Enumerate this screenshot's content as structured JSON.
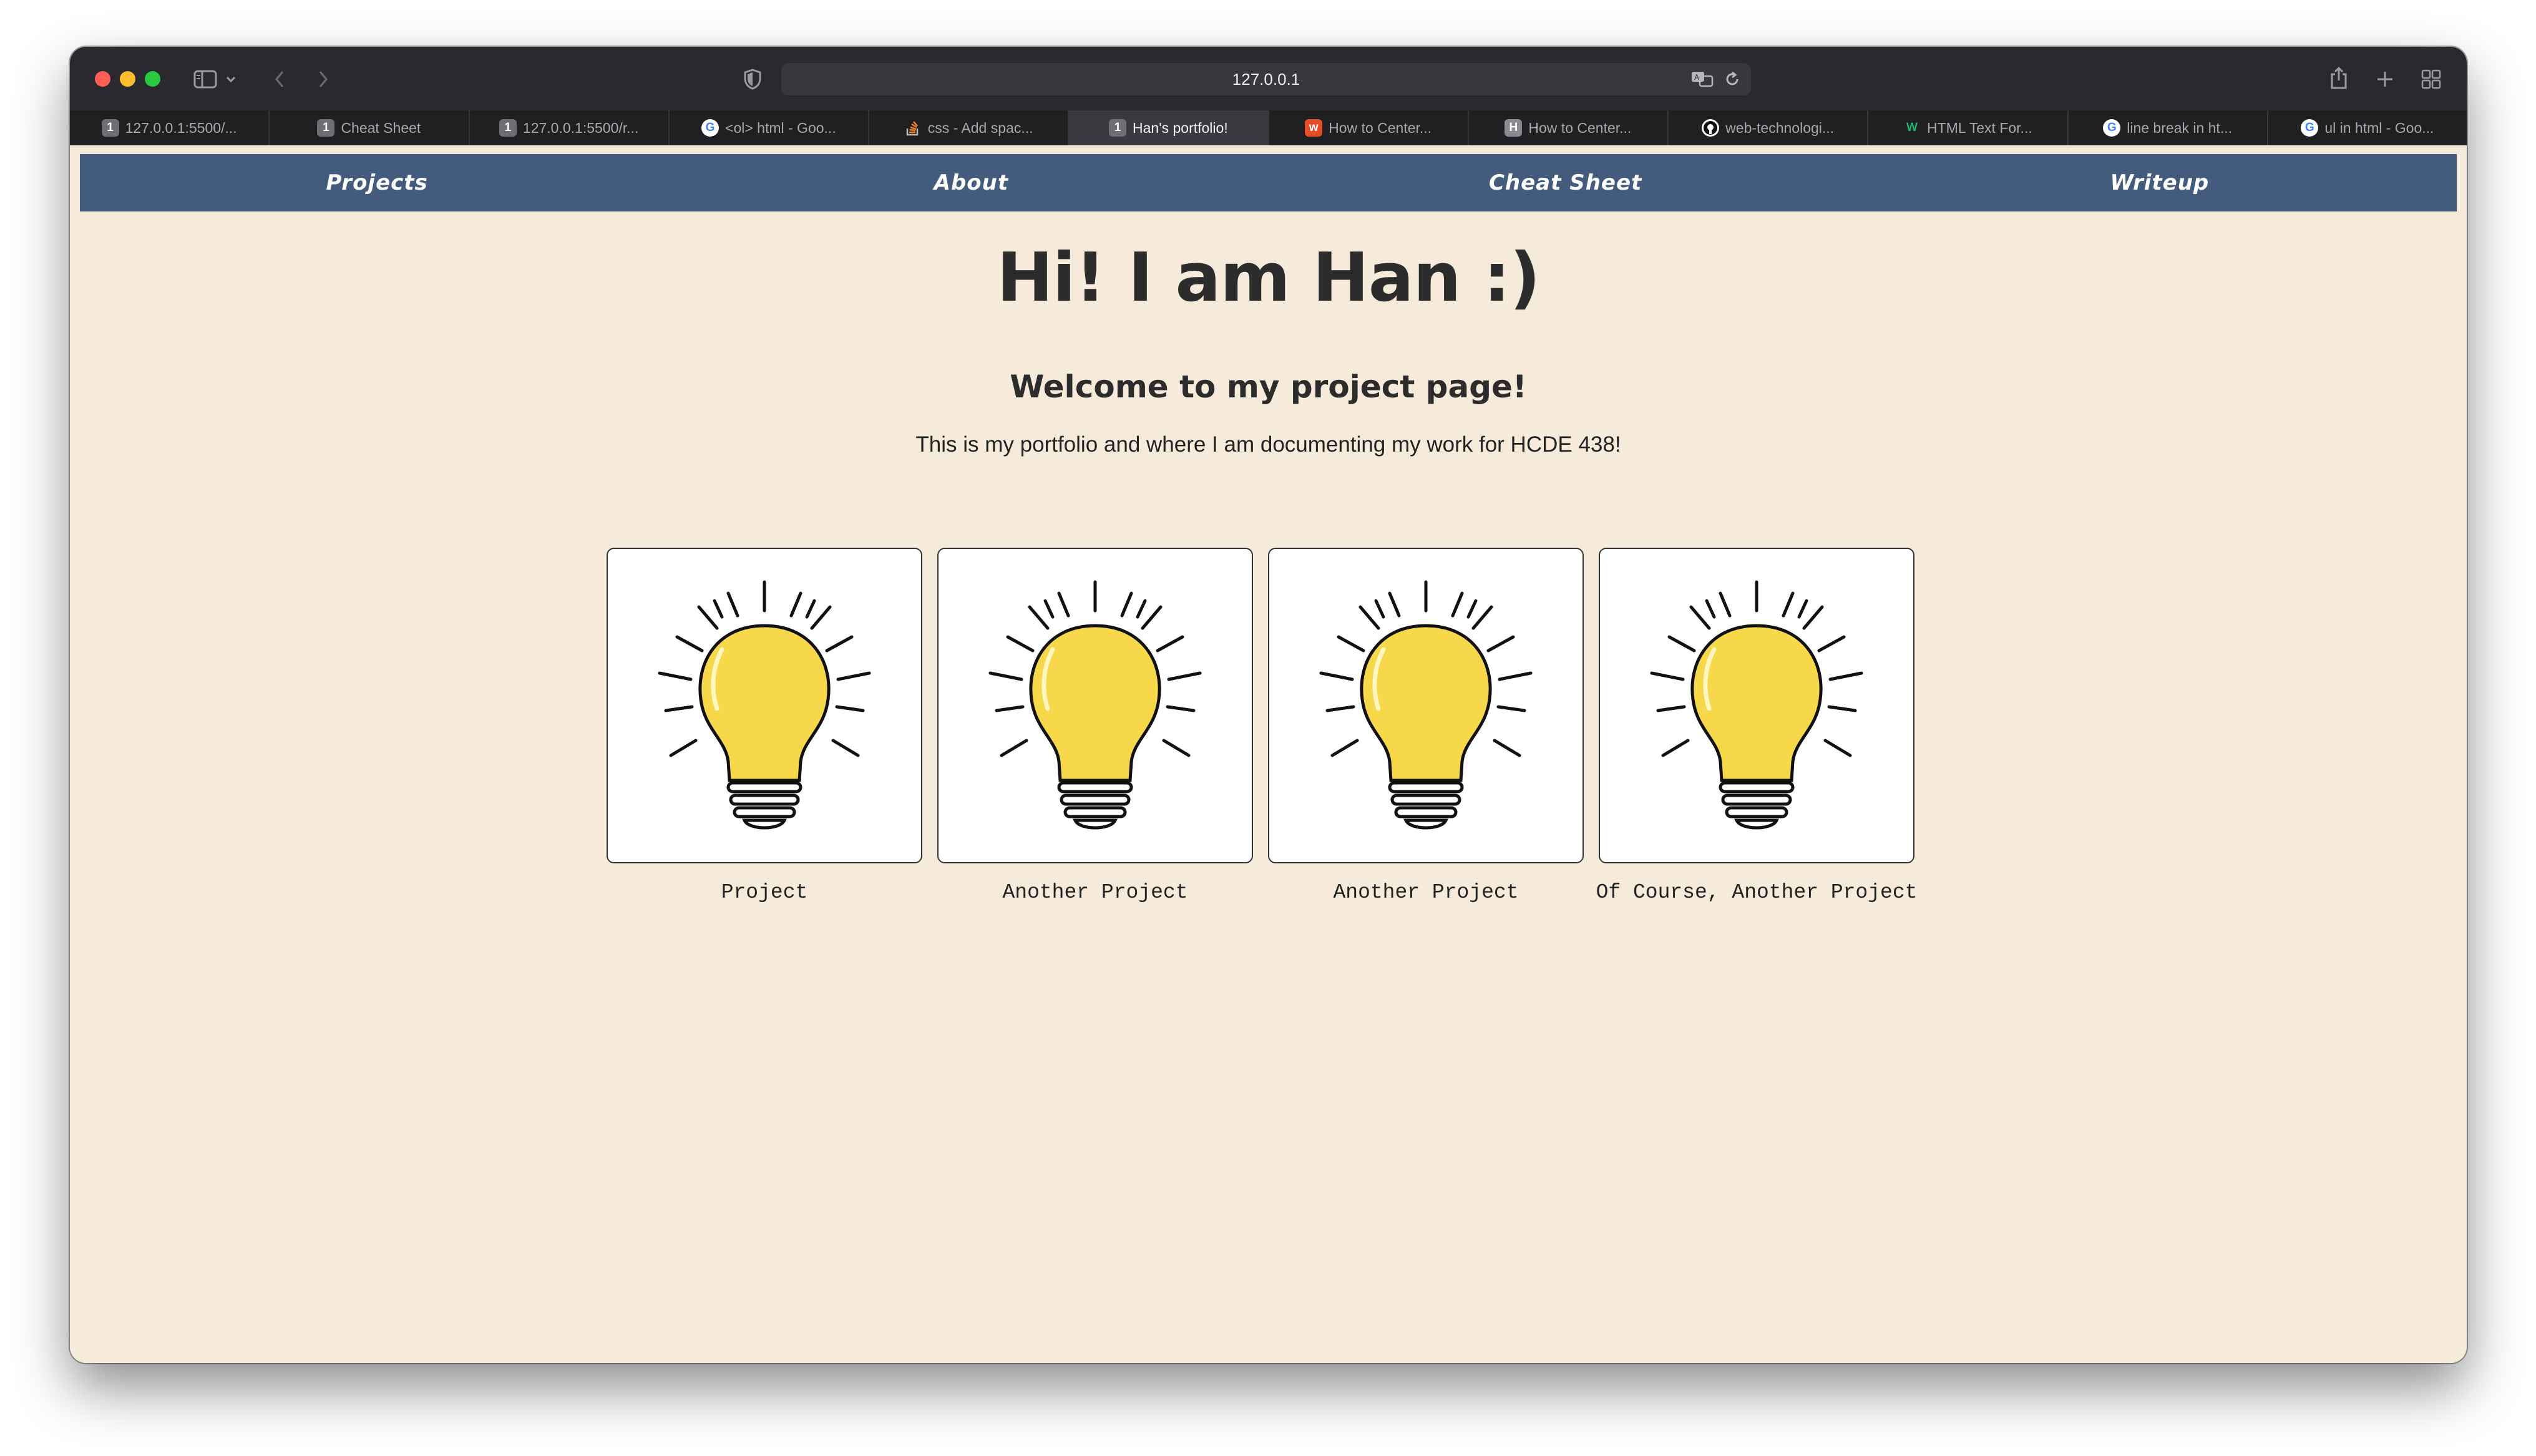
{
  "browser": {
    "address": "127.0.0.1",
    "tabs": [
      {
        "label": "127.0.0.1:5500/...",
        "favicon": "1",
        "active": false
      },
      {
        "label": "Cheat Sheet",
        "favicon": "1",
        "active": false
      },
      {
        "label": "127.0.0.1:5500/r...",
        "favicon": "1",
        "active": false
      },
      {
        "label": "<ol> html - Goo...",
        "favicon": "G",
        "active": false
      },
      {
        "label": "css - Add spac...",
        "favicon": "stack-overflow",
        "active": false
      },
      {
        "label": "Han's portfolio!",
        "favicon": "1",
        "active": true
      },
      {
        "label": "How to Center...",
        "favicon": "w3schools",
        "active": false
      },
      {
        "label": "How to Center...",
        "favicon": "H",
        "active": false
      },
      {
        "label": "web-technologi...",
        "favicon": "github",
        "active": false
      },
      {
        "label": "HTML Text For...",
        "favicon": "W",
        "active": false
      },
      {
        "label": "line break in ht...",
        "favicon": "G",
        "active": false
      },
      {
        "label": "ul in html - Goo...",
        "favicon": "G",
        "active": false
      }
    ]
  },
  "nav": {
    "items": [
      "Projects",
      "About",
      "Cheat Sheet",
      "Writeup"
    ]
  },
  "hero": {
    "title": "Hi! I am Han :)",
    "subtitle": "Welcome to my project page!",
    "description": "This is my portfolio and where I am documenting my work for HCDE 438!"
  },
  "projects": [
    {
      "caption": "Project",
      "icon": "lightbulb-icon"
    },
    {
      "caption": "Another Project",
      "icon": "lightbulb-icon"
    },
    {
      "caption": "Another Project",
      "icon": "lightbulb-icon"
    },
    {
      "caption": "Of Course, Another Project",
      "icon": "lightbulb-icon"
    }
  ],
  "colors": {
    "navbar": "#435b7c",
    "page_background": "#f6ebda",
    "bulb": "#f7d84a"
  }
}
